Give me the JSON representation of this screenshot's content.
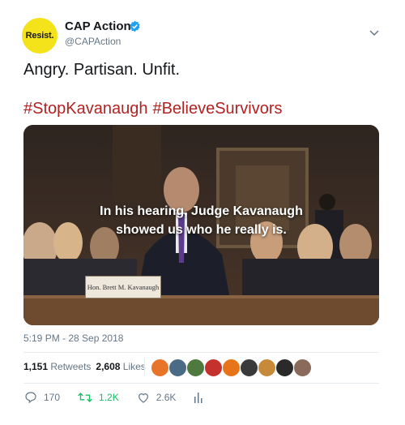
{
  "account": {
    "name": "CAP Action",
    "handle": "@CAPAction",
    "avatar_text": "Resist."
  },
  "tweet": {
    "text": "Angry. Partisan. Unfit.",
    "hashtags": [
      "#StopKavanaugh",
      "#BelieveSurvivors"
    ]
  },
  "media": {
    "caption_line1": "In his hearing, Judge Kavanaugh",
    "caption_line2": "showed us who he really is.",
    "nameplate": "Hon. Brett M. Kavanaugh"
  },
  "timestamp": "5:19 PM - 28 Sep 2018",
  "stats": {
    "retweets_count": "1,151",
    "retweets_label": "Retweets",
    "likes_count": "2,608",
    "likes_label": "Likes"
  },
  "actions": {
    "replies": "170",
    "retweets": "1.2K",
    "likes": "2.6K"
  },
  "colors": {
    "hashtag": "#b22222",
    "retweet_active": "#17bf63",
    "verified": "#1da1f2",
    "avatar_bg": "#f4e21a"
  },
  "liker_colors": [
    "#e8742a",
    "#4a6a86",
    "#4f7a3f",
    "#c5322e",
    "#e8741a",
    "#3a3a3a",
    "#c78a3a",
    "#2a2a2a",
    "#8a6a5a"
  ]
}
